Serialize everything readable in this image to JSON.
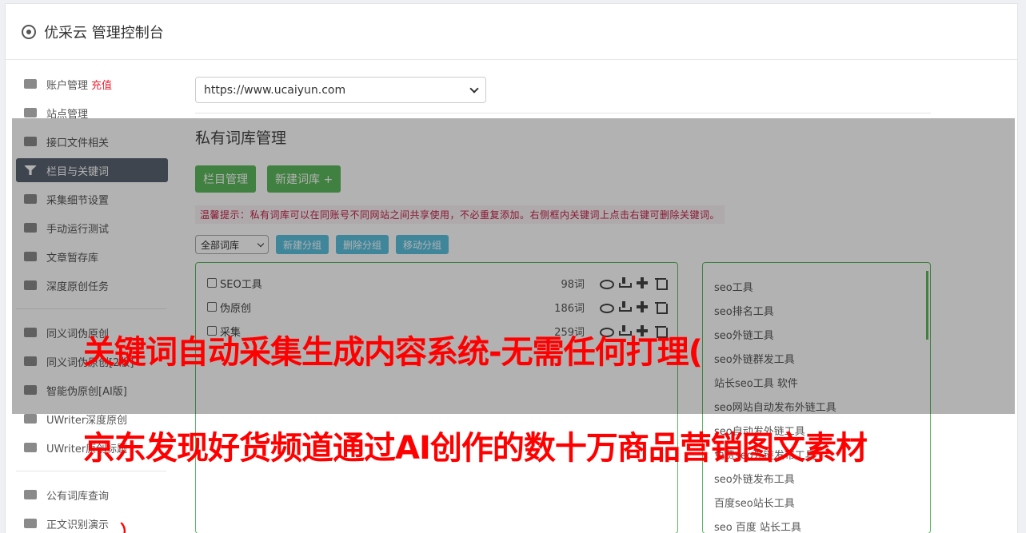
{
  "header": {
    "title": "优采云 管理控制台",
    "icon": "gear-icon"
  },
  "sidebar": {
    "group1": [
      {
        "label": "账户管理",
        "extra": "充值",
        "icon": "bar-chart-icon"
      },
      {
        "label": "站点管理",
        "icon": "server-icon"
      },
      {
        "label": "接口文件相关",
        "icon": "cloud-upload-icon"
      },
      {
        "label": "栏目与关键词",
        "icon": "filter-icon",
        "active": true
      },
      {
        "label": "采集细节设置",
        "icon": "cogs-icon"
      },
      {
        "label": "手动运行测试",
        "icon": "play-circle-icon"
      },
      {
        "label": "文章暂存库",
        "icon": "database-icon"
      },
      {
        "label": "深度原创任务",
        "icon": "edit-icon"
      }
    ],
    "group2": [
      {
        "label": "同义词伪原创",
        "icon": "refresh-icon"
      },
      {
        "label": "同义词伪原创[2版]",
        "icon": "refresh-icon"
      },
      {
        "label": "智能伪原创[AI版]",
        "icon": "refresh-icon"
      },
      {
        "label": "UWriter深度原创",
        "icon": "edit-icon"
      },
      {
        "label": "UWriter原创标题",
        "icon": "edit-icon"
      }
    ],
    "group3": [
      {
        "label": "公有词库查询",
        "icon": "book-icon"
      },
      {
        "label": "正文识别演示",
        "icon": "desktop-icon"
      }
    ]
  },
  "main": {
    "site_select": "https://www.ucaiyun.com",
    "section_title": "私有词库管理",
    "btn_column": "栏目管理",
    "btn_new_lib": "新建词库 +",
    "tip": "温馨提示：私有词库可以在同账号不同网站之间共享使用，不必重复添加。右侧框内关键词上点击右键可删除关键词。",
    "filter_select": "全部词库",
    "btn_new_group": "新建分组",
    "btn_del_group": "删除分组",
    "btn_move_group": "移动分组",
    "libraries": [
      {
        "name": "SEO工具",
        "count": "98词"
      },
      {
        "name": "伪原创",
        "count": "186词"
      },
      {
        "name": "采集",
        "count": "259词"
      }
    ],
    "keywords": [
      "seo工具",
      "seo排名工具",
      "seo外链工具",
      "seo外链群发工具",
      "站长seo工具 软件",
      "seo网站自动发布外链工具",
      "seo自动发外链工具",
      "免费seo外链发布工具",
      "seo外链发布工具",
      "百度seo站长工具",
      "seo 百度 站长工具"
    ]
  },
  "overlay": {
    "line1": "关键词自动采集生成内容系统-无需任何打理(",
    "line2": "京东发现好货频道通过AI创作的数十万商品营销图文素材",
    "line3": "）"
  }
}
